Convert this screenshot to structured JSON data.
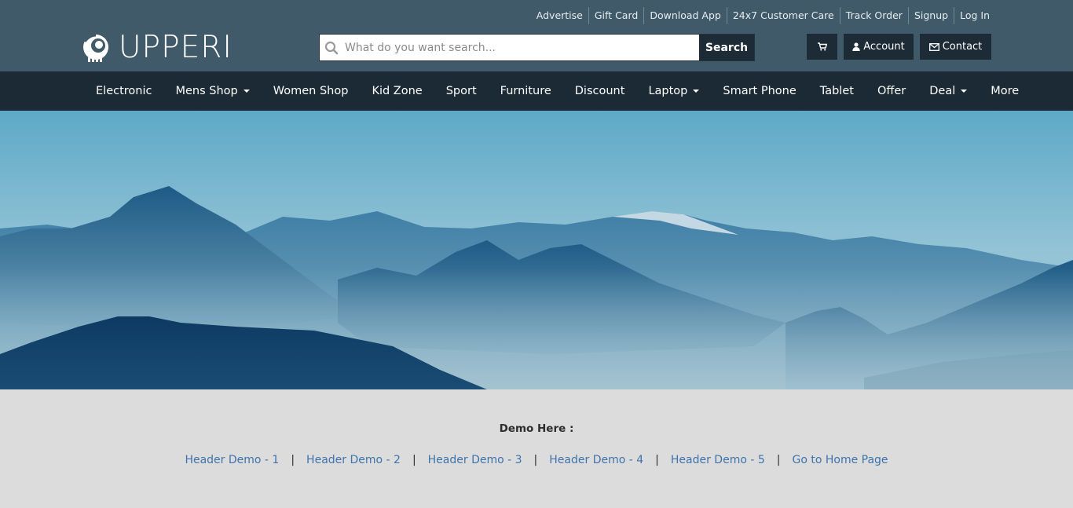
{
  "top_links": [
    "Advertise",
    "Gift Card",
    "Download App",
    "24x7 Customer Care",
    "Track Order",
    "Signup",
    "Log In"
  ],
  "logo": {
    "text": "UPPERI"
  },
  "search": {
    "placeholder": "What do you want search...",
    "button_label": "Search"
  },
  "header_buttons": {
    "account_label": "Account",
    "contact_label": "Contact"
  },
  "nav": [
    {
      "label": "Electronic",
      "dropdown": false
    },
    {
      "label": "Mens Shop",
      "dropdown": true
    },
    {
      "label": "Women Shop",
      "dropdown": false
    },
    {
      "label": "Kid Zone",
      "dropdown": false
    },
    {
      "label": "Sport",
      "dropdown": false
    },
    {
      "label": "Furniture",
      "dropdown": false
    },
    {
      "label": "Discount",
      "dropdown": false
    },
    {
      "label": "Laptop",
      "dropdown": true
    },
    {
      "label": "Smart Phone",
      "dropdown": false
    },
    {
      "label": "Tablet",
      "dropdown": false
    },
    {
      "label": "Offer",
      "dropdown": false
    },
    {
      "label": "Deal",
      "dropdown": true
    },
    {
      "label": "More",
      "dropdown": false
    }
  ],
  "demo": {
    "title": "Demo Here :",
    "links": [
      "Header Demo - 1",
      "Header Demo - 2",
      "Header Demo - 3",
      "Header Demo - 4",
      "Header Demo - 5",
      "Go to Home Page"
    ],
    "separator": "|"
  },
  "colors": {
    "header_bg": "#405a6a",
    "nav_bg": "#1b2a34",
    "button_bg": "#1c2b35",
    "link_color": "#3e74ab",
    "page_bg": "#dcdcdc"
  }
}
